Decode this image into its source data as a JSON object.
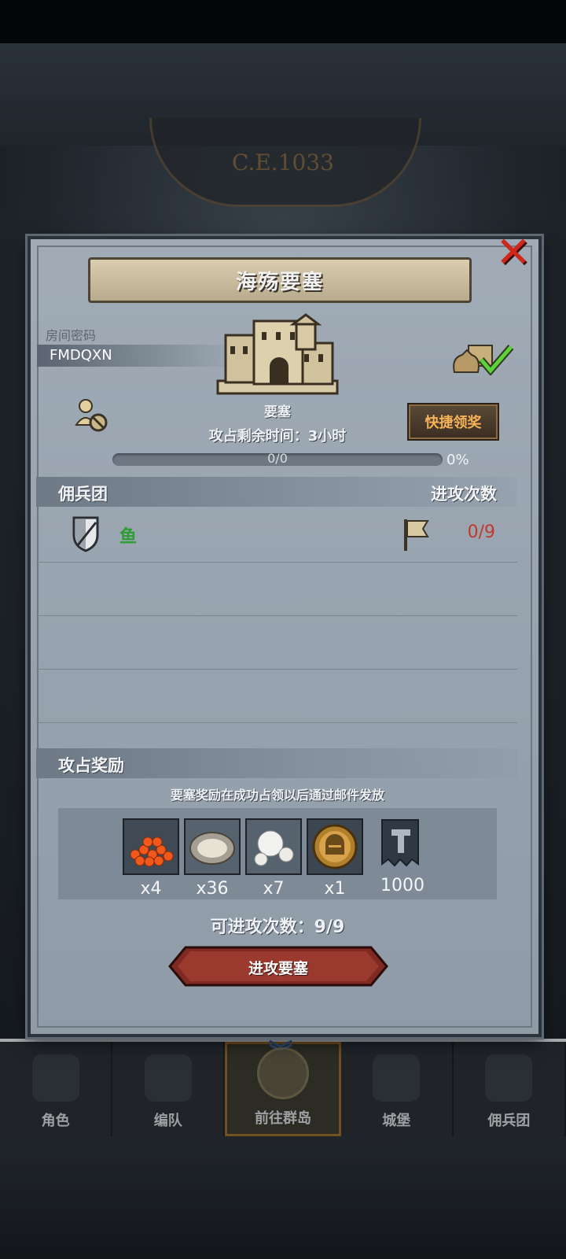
{
  "background": {
    "era_text": "C.E.1033"
  },
  "dialog": {
    "title": "海殇要塞",
    "room": {
      "label": "房间密码",
      "code": "FMDQXN"
    },
    "building_label": "要塞",
    "quick_claim_label": "快捷领奖",
    "time_remaining": "攻占剩余时间：3小时",
    "progress": {
      "text": "0/0",
      "percent_label": "0%",
      "fraction": 0
    },
    "mercenary_section": {
      "title": "佣兵团",
      "right_header": "进攻次数",
      "rows": [
        {
          "name": "鱼",
          "attacks": "0/9"
        }
      ]
    },
    "reward_section": {
      "title": "攻占奖励",
      "note": "要塞奖励在成功占领以后通过邮件发放",
      "items": [
        {
          "icon": "fish-roe-icon",
          "qty": "x4"
        },
        {
          "icon": "oyster-icon",
          "qty": "x36"
        },
        {
          "icon": "pearl-icon",
          "qty": "x7"
        },
        {
          "icon": "knight-helmet-coin-icon",
          "qty": "x1"
        },
        {
          "icon": "guild-banner-icon",
          "qty": "1000"
        }
      ]
    },
    "available_attacks": "可进攻次数：9/9",
    "attack_button_label": "进攻要塞"
  },
  "nav": {
    "items": [
      {
        "label": "角色",
        "icon": "knight-icon"
      },
      {
        "label": "编队",
        "icon": "formation-icon"
      },
      {
        "label": "前往群岛",
        "icon": "globe-icon",
        "active": true
      },
      {
        "label": "城堡",
        "icon": "castle-icon"
      },
      {
        "label": "佣兵团",
        "icon": "mercenary-icon"
      }
    ]
  },
  "colors": {
    "dialog_bg": "#97a3ae",
    "accent_gold": "#f6b357",
    "merc_green": "#2f9c35",
    "count_red": "#c23a2c",
    "close_red": "#d0271d",
    "attack_button": "#8c2f26"
  }
}
